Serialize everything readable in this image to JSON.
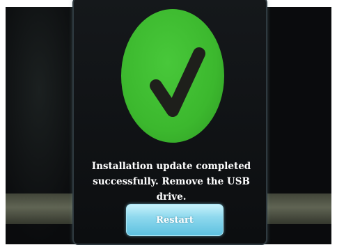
{
  "dialog": {
    "icon": "checkmark-icon",
    "message": "Installation update completed\nsuccessfully. Remove the USB drive.",
    "restart_label": "Restart"
  },
  "colors": {
    "success_green": "#3cb82e",
    "button_cyan": "#8fd9ee",
    "background": "#0a0b0d"
  }
}
